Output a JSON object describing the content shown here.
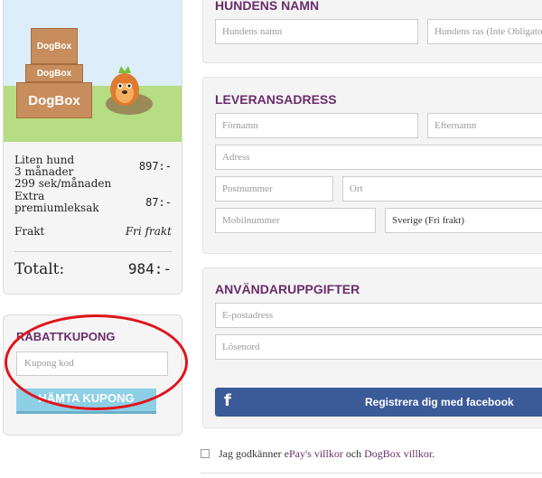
{
  "product": {
    "box_labels": [
      "DogBox",
      "DogBox",
      "DogBox"
    ]
  },
  "order_summary": {
    "items": [
      {
        "lines": [
          "Liten hund",
          "3 månader",
          "299 sek/månaden"
        ],
        "amount": "897:-"
      },
      {
        "lines": [
          "Extra",
          "premiumleksak"
        ],
        "amount": "87:-"
      },
      {
        "lines": [
          "Frakt"
        ],
        "amount": "Fri frakt"
      }
    ],
    "total_label": "Totalt:",
    "total_amount": "984:-"
  },
  "coupon": {
    "title": "RABATTKUPONG",
    "placeholder": "Kupong kod",
    "button_label": "HÄMTA KUPONG"
  },
  "dog_name": {
    "title": "HUNDENS NAMN",
    "name_placeholder": "Hundens namn",
    "breed_placeholder": "Hundens ras (Inte Obligatoriskt)"
  },
  "delivery": {
    "title": "LEVERANSADRESS",
    "first_name": "Förnamn",
    "last_name": "Efternamn",
    "address": "Adress",
    "postcode": "Postnummer",
    "city": "Ort",
    "mobile": "Mobilnummer",
    "country": "Sverige (Fri frakt)"
  },
  "account": {
    "title": "ANVÄNDARUPPGIFTER",
    "email": "E-postadress",
    "password": "Lösenord",
    "facebook_button": "Registrera dig med facebook"
  },
  "terms": {
    "prefix": "Jag godkänner ",
    "epay_link": "ePay's villkor",
    "middle": " och ",
    "dogbox_link": "DogBox villkor",
    "suffix": "."
  },
  "colors": {
    "accent_purple": "#6a2d6b",
    "facebook_blue": "#3b5a98",
    "coupon_button": "#8dd0e6",
    "highlight_red": "#e0141b"
  }
}
